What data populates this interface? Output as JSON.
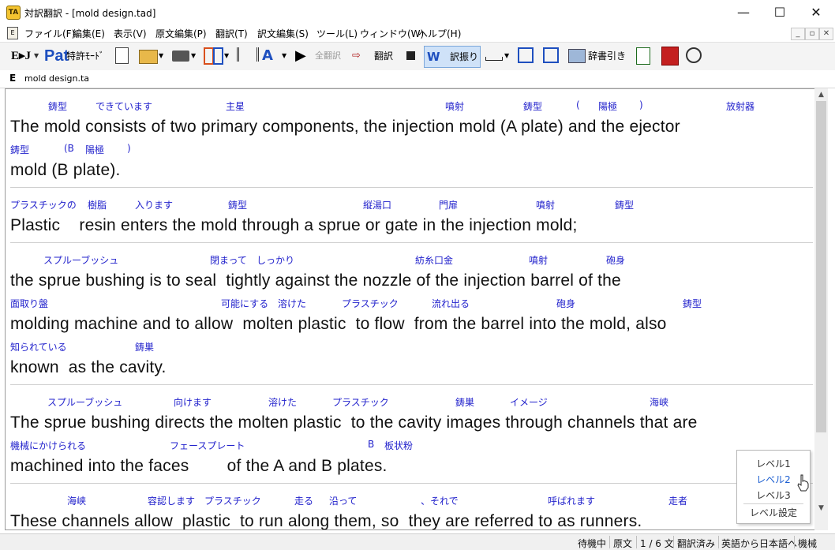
{
  "window": {
    "title": "対訳翻訳 - [mold design.tad]",
    "app_icon": "TA",
    "minimize": "—",
    "maximize": "☐",
    "close": "✕"
  },
  "menu": {
    "doc_icon": "E",
    "items": [
      "ファイル(F)",
      "編集(E)",
      "表示(V)",
      "原文編集(P)",
      "翻訳(T)",
      "訳文編集(S)",
      "ツール(L)",
      "ウィンドウ(W)",
      "ヘルプ(H)"
    ],
    "mdi_min": "_",
    "mdi_restore": "▫",
    "mdi_close": "✕"
  },
  "toolbar": {
    "ej_label": "E▸J",
    "patent_label": "特許ﾓｰﾄﾞ",
    "translate_all": "全翻訳",
    "translate": "翻訳",
    "word_break": "訳振り",
    "dict_lookup": "辞書引き",
    "accent_color": "#1e4fbf"
  },
  "tab": {
    "marker": "E",
    "label": "mold design.ta"
  },
  "sentences": [
    {
      "lines": [
        {
          "glosses": [
            "鋳型",
            "できています",
            "主星",
            "噴射",
            "鋳型",
            "(",
            "陽極",
            ")",
            "放射器"
          ],
          "text": "The mold consists of two primary components, the injection mold (A plate) and the ejector"
        },
        {
          "glosses": [
            "鋳型",
            "(B",
            "陽極",
            ")"
          ],
          "text": "mold (B plate)."
        }
      ]
    },
    {
      "lines": [
        {
          "glosses": [
            "プラスチックの",
            "樹脂",
            "入ります",
            "鋳型",
            "縦湯口",
            "門扉",
            "噴射",
            "鋳型"
          ],
          "text": "Plastic    resin enters the mold through a sprue or gate in the injection mold;"
        }
      ]
    },
    {
      "lines": [
        {
          "glosses": [
            "スプルーブッシュ",
            "閉まって",
            "しっかり",
            "紡糸口金",
            "噴射",
            "砲身"
          ],
          "text": "the sprue bushing is to seal  tightly against the nozzle of the injection barrel of the"
        },
        {
          "glosses": [
            "面取り盤",
            "可能にする",
            "溶けた",
            "プラスチック",
            "流れ出る",
            "砲身",
            "鋳型"
          ],
          "text": "molding machine and to allow  molten plastic  to flow  from the barrel into the mold, also"
        },
        {
          "glosses": [
            "知られている",
            "鋳巣"
          ],
          "text": "known  as the cavity."
        }
      ]
    },
    {
      "lines": [
        {
          "glosses": [
            "スプルーブッシュ",
            "向けます",
            "溶けた",
            "プラスチック",
            "鋳巣",
            "イメージ",
            "海峡"
          ],
          "text": "The sprue bushing directs the molten plastic  to the cavity images through channels that are"
        },
        {
          "glosses": [
            "機械にかけられる",
            "フェースプレート",
            "B",
            "板状粉"
          ],
          "text": "machined into the faces        of the A and B plates."
        }
      ]
    },
    {
      "lines": [
        {
          "glosses": [
            "海峡",
            "容認します",
            "プラスチック",
            "走る",
            "沿って",
            "、それで",
            "呼ばれます",
            "走者"
          ],
          "text": "These channels allow  plastic  to run along them, so  they are referred to as runners."
        }
      ]
    }
  ],
  "level_popup": {
    "items": [
      "レベル1",
      "レベル2",
      "レベル3"
    ],
    "settings": "レベル設定",
    "highlight_color": "#1d5fd1"
  },
  "scrollbar": {
    "up": "▲",
    "down": "▼"
  },
  "status": {
    "items": [
      "待機中",
      "原文",
      "1 / 6 文",
      "翻訳済み",
      "英語から日本語へ",
      "機械"
    ]
  }
}
